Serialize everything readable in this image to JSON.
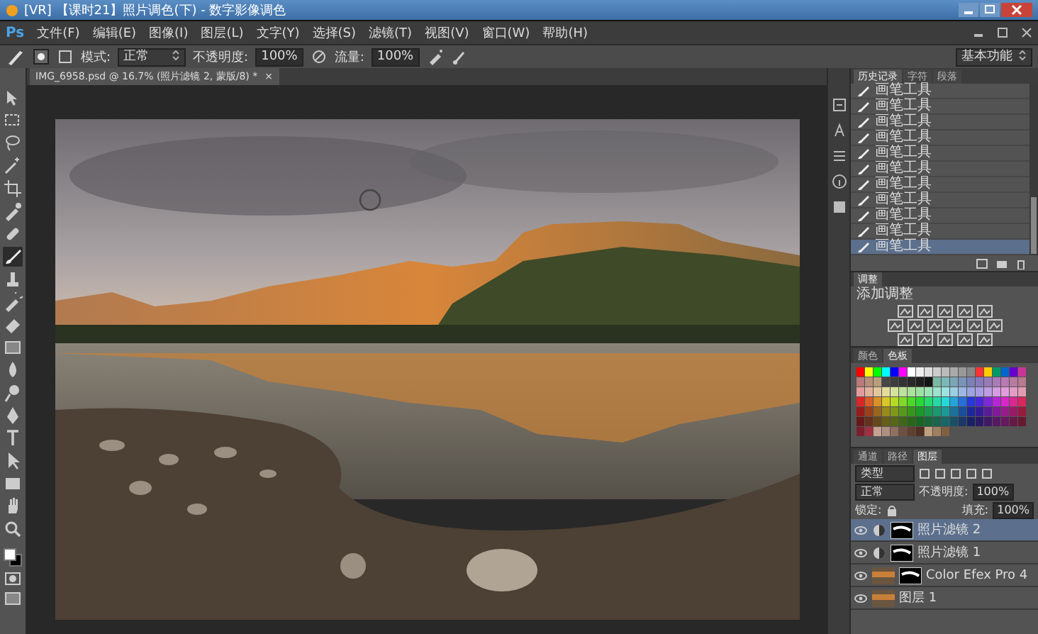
{
  "window": {
    "title": "[VR] 【课时21】照片调色(下) - 数字影像调色"
  },
  "menubar": {
    "logo": "Ps",
    "items": [
      "文件(F)",
      "编辑(E)",
      "图像(I)",
      "图层(L)",
      "文字(Y)",
      "选择(S)",
      "滤镜(T)",
      "视图(V)",
      "窗口(W)",
      "帮助(H)"
    ]
  },
  "options": {
    "mode_label": "模式:",
    "mode": "正常",
    "opacity_label": "不透明度:",
    "opacity": "100%",
    "flow_label": "流量:",
    "flow": "100%",
    "workspace": "基本功能"
  },
  "toolbar": {
    "tools": [
      {
        "kind": "move",
        "selected": false
      },
      {
        "kind": "marquee",
        "selected": false
      },
      {
        "kind": "lasso",
        "selected": false
      },
      {
        "kind": "wand",
        "selected": false
      },
      {
        "kind": "crop",
        "selected": false
      },
      {
        "kind": "eyedropper",
        "selected": false
      },
      {
        "kind": "healing",
        "selected": false
      },
      {
        "kind": "brush",
        "selected": true
      },
      {
        "kind": "stamp",
        "selected": false
      },
      {
        "kind": "history",
        "selected": false
      },
      {
        "kind": "eraser",
        "selected": false
      },
      {
        "kind": "gradient",
        "selected": false
      },
      {
        "kind": "blur",
        "selected": false
      },
      {
        "kind": "dodge",
        "selected": false
      },
      {
        "kind": "pen",
        "selected": false
      },
      {
        "kind": "type",
        "selected": false
      },
      {
        "kind": "select",
        "selected": false
      },
      {
        "kind": "shape",
        "selected": false
      },
      {
        "kind": "hand",
        "selected": false
      },
      {
        "kind": "zoom",
        "selected": false
      }
    ]
  },
  "document_tab": {
    "label": "IMG_6958.psd @ 16.7% (照片滤镜 2, 蒙版/8) *",
    "close": "×"
  },
  "history": {
    "tabs": [
      {
        "label": "历史记录",
        "selected": true
      },
      {
        "label": "字符",
        "selected": false
      },
      {
        "label": "段落",
        "selected": false
      }
    ],
    "items": [
      {
        "label": "画笔工具",
        "selected": false
      },
      {
        "label": "画笔工具",
        "selected": false
      },
      {
        "label": "画笔工具",
        "selected": false
      },
      {
        "label": "画笔工具",
        "selected": false
      },
      {
        "label": "画笔工具",
        "selected": false
      },
      {
        "label": "画笔工具",
        "selected": false
      },
      {
        "label": "画笔工具",
        "selected": false
      },
      {
        "label": "画笔工具",
        "selected": false
      },
      {
        "label": "画笔工具",
        "selected": false
      },
      {
        "label": "画笔工具",
        "selected": false
      },
      {
        "label": "画笔工具",
        "selected": true
      }
    ]
  },
  "adjustments": {
    "tab": "调整",
    "subtitle": "添加调整"
  },
  "swatches": {
    "tabs": [
      {
        "label": "颜色",
        "selected": false
      },
      {
        "label": "色板",
        "selected": true
      }
    ]
  },
  "layers": {
    "tabs": [
      {
        "label": "通道",
        "selected": false
      },
      {
        "label": "路径",
        "selected": false
      },
      {
        "label": "图层",
        "selected": true
      }
    ],
    "filter": "类型",
    "blend": "正常",
    "opacity_label": "不透明度:",
    "opacity": "100%",
    "lock_label": "锁定:",
    "fill_label": "填充:",
    "fill": "100%",
    "items": [
      {
        "name": "照片滤镜 2",
        "kind": "adjustment",
        "visible": true,
        "selected": true
      },
      {
        "name": "照片滤镜 1",
        "kind": "adjustment",
        "visible": true,
        "selected": false
      },
      {
        "name": "Color Efex Pro 4",
        "kind": "masked",
        "visible": true,
        "selected": false
      },
      {
        "name": "图层 1",
        "kind": "pixel",
        "visible": true,
        "selected": false
      }
    ]
  }
}
